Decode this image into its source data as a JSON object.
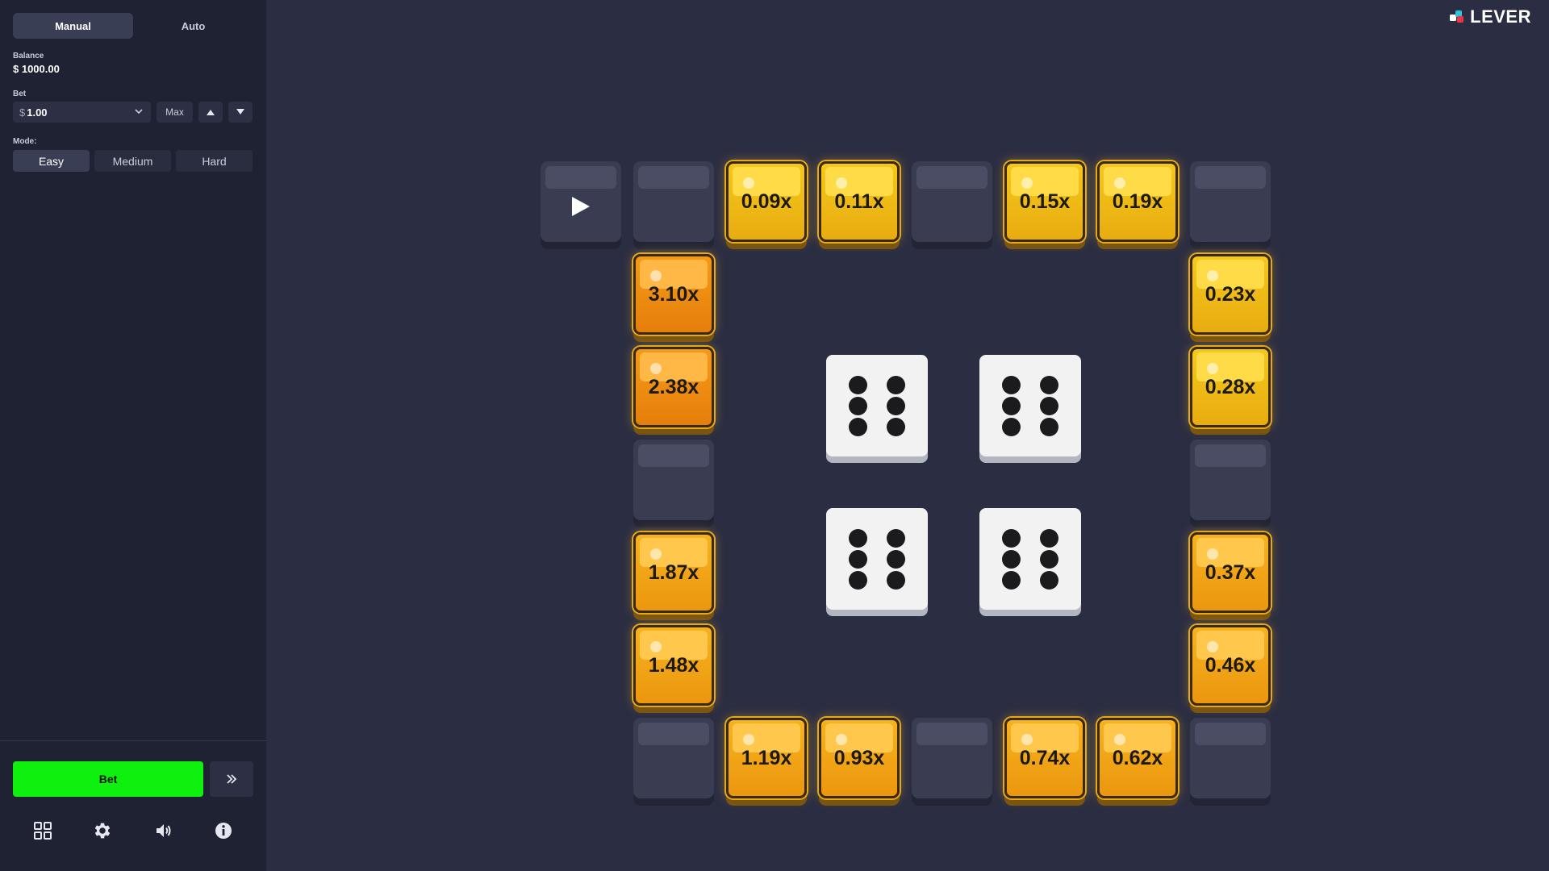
{
  "sidebar": {
    "tabs": [
      {
        "label": "Manual",
        "active": true
      },
      {
        "label": "Auto",
        "active": false
      }
    ],
    "balance": {
      "label": "Balance",
      "value": "$ 1000.00"
    },
    "bet": {
      "label": "Bet",
      "currency": "$",
      "value": "1.00",
      "max_label": "Max"
    },
    "mode": {
      "label": "Mode:",
      "options": [
        {
          "label": "Easy",
          "active": true
        },
        {
          "label": "Medium",
          "active": false
        },
        {
          "label": "Hard",
          "active": false
        }
      ]
    },
    "bet_button": "Bet",
    "bet_button_color": "#0ef10e",
    "auto_button_icon": "double-chevron-right-icon",
    "bottom_icons": [
      "grid-icon",
      "gear-icon",
      "speaker-icon",
      "info-icon"
    ]
  },
  "logo": {
    "text": "LEVER"
  },
  "board": {
    "start_icon": "play-icon",
    "top_row": [
      "start",
      "",
      "0.09x",
      "0.11x",
      "",
      "0.15x",
      "0.19x",
      ""
    ],
    "left_column": [
      "3.10x",
      "2.38x",
      "",
      "1.87x",
      "1.48x"
    ],
    "right_column": [
      "0.23x",
      "0.28x",
      "",
      "0.37x",
      "0.46x"
    ],
    "bottom_row": [
      "",
      "1.19x",
      "0.93x",
      "",
      "0.74x",
      "0.62x",
      ""
    ]
  },
  "dice": [
    6,
    6,
    6,
    6
  ]
}
